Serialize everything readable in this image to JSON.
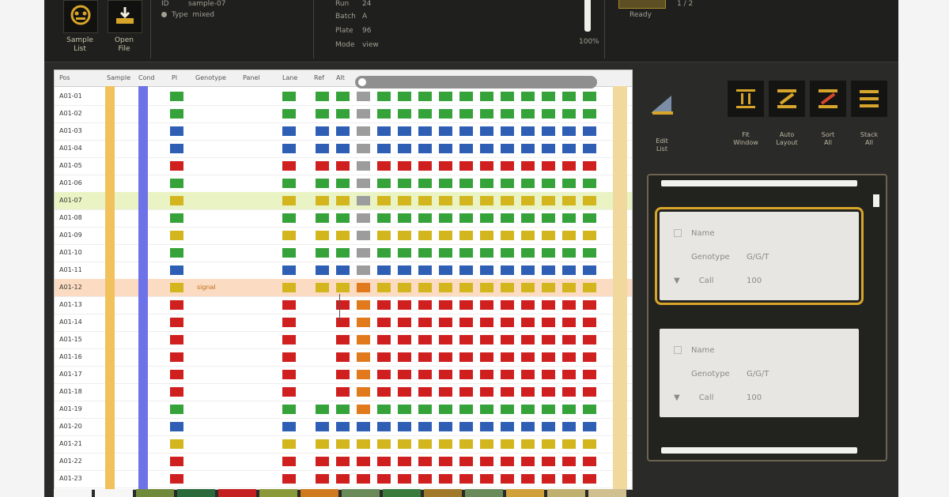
{
  "toolbar": {
    "buttons": [
      {
        "label": "Sample\nList",
        "icon": "sample-list-icon"
      },
      {
        "label": "Open\nFile",
        "icon": "open-file-icon"
      }
    ],
    "info_left": [
      {
        "key": "ID",
        "value": "sample-07"
      },
      {
        "key": "Type",
        "value": "mixed"
      }
    ],
    "info_right": [
      {
        "key": "Run",
        "value": "24"
      },
      {
        "key": "Batch",
        "value": "A"
      },
      {
        "key": "Plate",
        "value": "96"
      },
      {
        "key": "Mode",
        "value": "view"
      }
    ],
    "status_label": "Ready",
    "status_value": "1 / 2",
    "zoom_label": "100%"
  },
  "grid": {
    "headers": [
      "Pos",
      "Sample",
      "Cond",
      "Pl",
      "Genotype",
      "Panel",
      "Lane",
      "Ref",
      "Alt"
    ],
    "rows": [
      "A01-01",
      "A01-02",
      "A01-03",
      "A01-04",
      "A01-05",
      "A01-06",
      "A01-07",
      "A01-08",
      "A01-09",
      "A01-10",
      "A01-11",
      "A01-12",
      "A01-13",
      "A01-14",
      "A01-15",
      "A01-16",
      "A01-17",
      "A01-18",
      "A01-19",
      "A01-20",
      "A01-21",
      "A01-22",
      "A01-23"
    ],
    "row_colors": [
      "green",
      "green",
      "blue",
      "blue",
      "red",
      "green",
      "yellow",
      "green",
      "yellow",
      "green",
      "blue",
      "yellow",
      "red",
      "red",
      "red",
      "red",
      "red",
      "red",
      "green",
      "blue",
      "yellow",
      "red",
      "red"
    ],
    "note_text": "signal",
    "highlight_rows": {
      "green": 6,
      "orange": 11
    }
  },
  "right_tools": [
    {
      "label": "Edit\nList",
      "icon": "edit-list-icon"
    },
    {
      "label": "Fit\nWindow",
      "icon": "fit-window-icon"
    },
    {
      "label": "Auto\nLayout",
      "icon": "auto-layout-icon"
    },
    {
      "label": "Sort\nAll",
      "icon": "sort-icon"
    },
    {
      "label": "Stack\nAll",
      "icon": "stack-icon"
    }
  ],
  "inspector": {
    "cards": [
      {
        "name_label": "Name",
        "row2_label": "Genotype",
        "row2_value": "G/G/T",
        "row3_label": "Call",
        "row3_value": "100"
      },
      {
        "name_label": "Name",
        "row2_label": "Genotype",
        "row2_value": "G/G/T",
        "row3_label": "Call",
        "row3_value": "100"
      }
    ]
  },
  "colors": {
    "green": "#36a33a",
    "blue": "#2f5fb5",
    "red": "#d01f1f",
    "yellow": "#d3b51d",
    "orange": "#e07a1d",
    "gold": "#d7a52a",
    "strip_yellow": "#f1c15c",
    "strip_blue": "#6e72e8"
  }
}
